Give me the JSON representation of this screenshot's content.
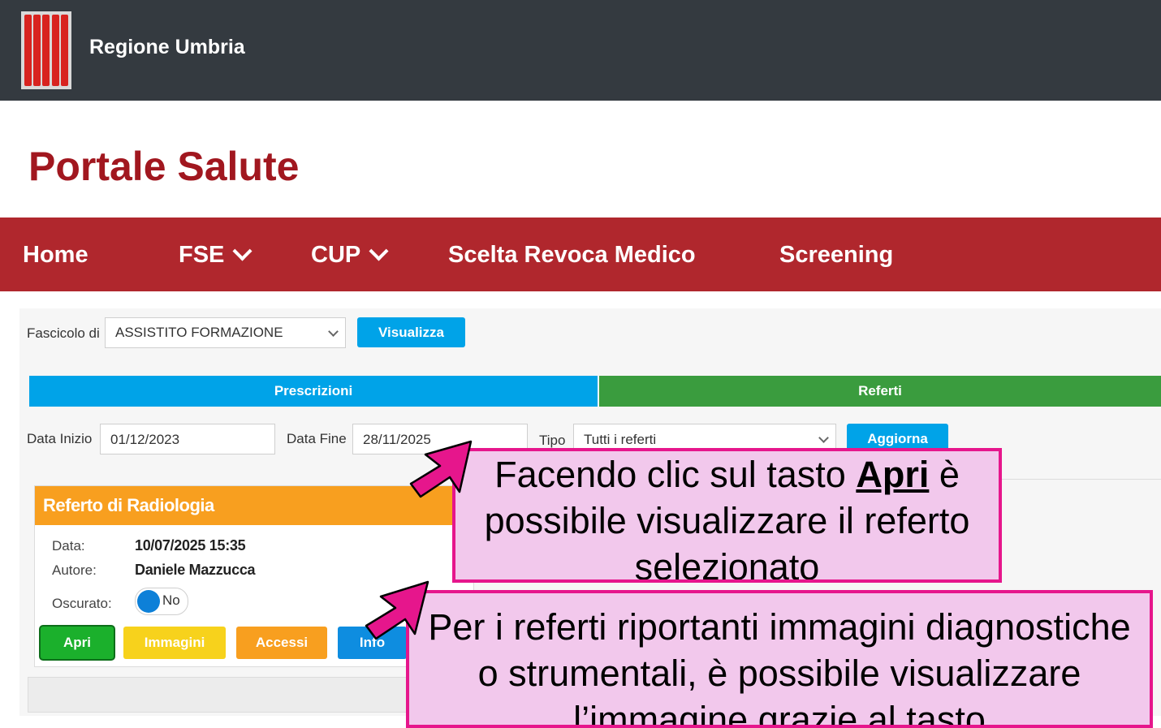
{
  "header": {
    "region_name": "Regione Umbria"
  },
  "portal": {
    "title": "Portale Salute"
  },
  "nav": {
    "home": "Home",
    "fse": "FSE",
    "cup": "CUP",
    "scelta": "Scelta Revoca Medico",
    "screening": "Screening"
  },
  "fascicolo": {
    "label": "Fascicolo di",
    "selected": "ASSISTITO FORMAZIONE",
    "button": "Visualizza"
  },
  "tabs": {
    "prescrizioni": "Prescrizioni",
    "referti": "Referti"
  },
  "filters": {
    "data_inizio_label": "Data Inizio",
    "data_inizio_value": "01/12/2023",
    "data_fine_label": "Data Fine",
    "data_fine_value": "28/11/2025",
    "tipo_label": "Tipo",
    "tipo_value": "Tutti i referti",
    "aggiorna": "Aggiorna"
  },
  "card": {
    "title": "Referto di Radiologia",
    "data_label": "Data:",
    "data_value": "10/07/2025 15:35",
    "autore_label": "Autore:",
    "autore_value": "Daniele Mazzucca",
    "oscurato_label": "Oscurato:",
    "oscurato_value": "No",
    "buttons": {
      "apri": "Apri",
      "immagini": "Immagini",
      "accessi": "Accessi",
      "info": "Info"
    }
  },
  "callouts": {
    "first_before": "Facendo clic sul tasto ",
    "first_bold": "Apri",
    "first_after": " è possibile visualizzare il referto selezionato",
    "second": "Per i referti riportanti immagini diagnostiche o strumentali, è possibile visualizzare l’immagine grazie al tasto"
  },
  "colors": {
    "header_bg": "#343a40",
    "nav_bg": "#b0272d",
    "title": "#a1171f",
    "blue": "#00a3e8",
    "green_tab": "#3a9c3e",
    "orange": "#f89f1f",
    "callout_bg": "#f2c8ec",
    "callout_border": "#e6168c"
  }
}
